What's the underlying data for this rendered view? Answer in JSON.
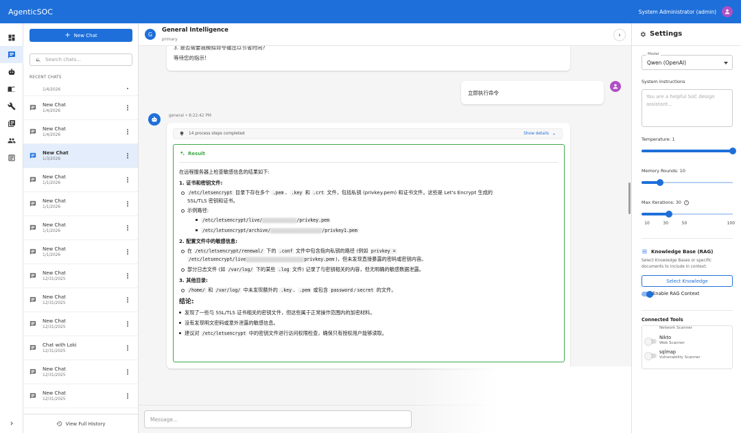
{
  "app": {
    "title": "AgenticSOC",
    "user": "System Administrator (admin)"
  },
  "sidebar": {
    "new_chat": "New Chat",
    "search_placeholder": "Search chats...",
    "recent_label": "RECENT CHATS",
    "view_history": "View Full History",
    "items": [
      {
        "name": "",
        "date": "1/4/2026"
      },
      {
        "name": "New Chat",
        "date": "1/4/2026"
      },
      {
        "name": "New Chat",
        "date": "1/4/2026"
      },
      {
        "name": "New Chat",
        "date": "1/3/2026"
      },
      {
        "name": "New Chat",
        "date": "1/1/2026"
      },
      {
        "name": "New Chat",
        "date": "1/1/2026"
      },
      {
        "name": "New Chat",
        "date": "1/1/2026"
      },
      {
        "name": "New Chat",
        "date": "1/1/2026"
      },
      {
        "name": "New Chat",
        "date": "12/31/2025"
      },
      {
        "name": "New Chat",
        "date": "12/31/2025"
      },
      {
        "name": "New Chat",
        "date": "12/31/2025"
      },
      {
        "name": "Chat with Loki",
        "date": "12/31/2025"
      },
      {
        "name": "New Chat",
        "date": "12/31/2025"
      },
      {
        "name": "New Chat",
        "date": "12/31/2025"
      }
    ]
  },
  "chat": {
    "avatar_letter": "G",
    "title": "General Intelligence",
    "subtitle": "primary",
    "prev_line_cut": "3. 是否需要我模拟命令输出以节省时间?",
    "prev_line": "等待您的指示!",
    "user_message": "立即执行命令",
    "bot_meta": "general • 8:22:42 PM",
    "steps_text": "14 process steps completed",
    "show_details": "Show details",
    "result_title": "Result",
    "composer_placeholder": "Message..."
  },
  "result": {
    "intro": "在远程服务器上检查敏感信息的结果如下:",
    "h1": "1. 证书和密钥文件:",
    "s1a_pre": "/etc/letsencrypt",
    "s1a_mid": " 目录下存在多个 ",
    "s1a_c1": ".pem",
    "s1a_sep1": "、",
    "s1a_c2": ".key",
    "s1a_and": " 和 ",
    "s1a_c3": ".crt",
    "s1a_post": " 文件，包括私钥 (privkey.pem) 和证书文件。这些是 Let's Encrypt 生成的",
    "s1a_post2": "SSL/TLS 密钥和证书。",
    "s1b": "示例路径:",
    "p1_start": "/etc/letsencrypt/live/",
    "p1_end": "/privkey.pem",
    "p2_start": "/etc/letsencrypt/archive/",
    "p2_end": "/privkey1.pem",
    "h2": "2. 配置文件中的敏感信息:",
    "s2a_pre": "在 ",
    "s2a_c1": "/etc/letsencrypt/renewal/",
    "s2a_mid": " 下的 ",
    "s2a_c2": ".conf",
    "s2a_mid2": " 文件中包含指向私钥的路径 (例如 ",
    "s2a_c3": "privkey =",
    "s2a_c4": "/etc/letsencrypt/live",
    "s2a_c5": "privkey.pem",
    "s2a_post": ")，但未发现直接暴露的密码或密钥内容。",
    "s2b_pre": "部分日志文件 (如 ",
    "s2b_c1": "/var/log/",
    "s2b_mid": " 下的某些 ",
    "s2b_c2": ".log",
    "s2b_post": " 文件) 记录了与密钥相关的内容，但无明确的敏感数据泄露。",
    "h3": "3. 其他目录:",
    "s3_c1": "/home/",
    "s3_and": " 和 ",
    "s3_c2": "/var/log/",
    "s3_mid": " 中未发现额外的 ",
    "s3_c3": ".key",
    "s3_sep": "、",
    "s3_c4": ".pem",
    "s3_or": " 或包含 ",
    "s3_c5": "password",
    "s3_slash": "/",
    "s3_c6": "secret",
    "s3_post": " 的文件。",
    "conclusion": "结论:",
    "c1": "发现了一些与 SSL/TLS 证书相关的密钥文件，但这些属于正常操作范围内的加密材料。",
    "c2": "没有发现明文密码或意外泄露的敏感信息。",
    "c3_pre": "建议对 ",
    "c3_code": "/etc/letsencrypt",
    "c3_post": " 中的密钥文件进行访问权限检查，确保只有授权用户能够读取。"
  },
  "settings": {
    "title": "Settings",
    "model_label": "Model",
    "model_value": "Qwen (OpenAI)",
    "sys_label": "System Instructions",
    "sys_placeholder": "You are a helpful SoC design assistant...",
    "temperature_label": "Temperature: 1",
    "temperature": {
      "value": 1,
      "min": 0,
      "max": 1
    },
    "memory_label": "Memory Rounds: 10",
    "memory": {
      "value": 10,
      "min": 0,
      "max": 50
    },
    "iter_label": "Max Iterations: 30",
    "iterations": {
      "value": 30,
      "min": 0,
      "max": 100
    },
    "iter_ticks": [
      "10",
      "30",
      "50",
      "100"
    ],
    "kb_title": "Knowledge Base (RAG)",
    "kb_desc": "Select Knowledge Bases or specific documents to include in context.",
    "kb_button": "Select Knowledge",
    "rag_label": "Enable RAG Context",
    "tools_title": "Connected Tools",
    "tools": [
      {
        "name": "",
        "desc": "Network Scanner"
      },
      {
        "name": "Nikto",
        "desc": "Web Scanner"
      },
      {
        "name": "sqlmap",
        "desc": "Vulnerability Scanner"
      }
    ]
  },
  "colors": {
    "primary": "#1e6fd9",
    "success": "#3fa84a",
    "avatar": "#b04fc6"
  }
}
